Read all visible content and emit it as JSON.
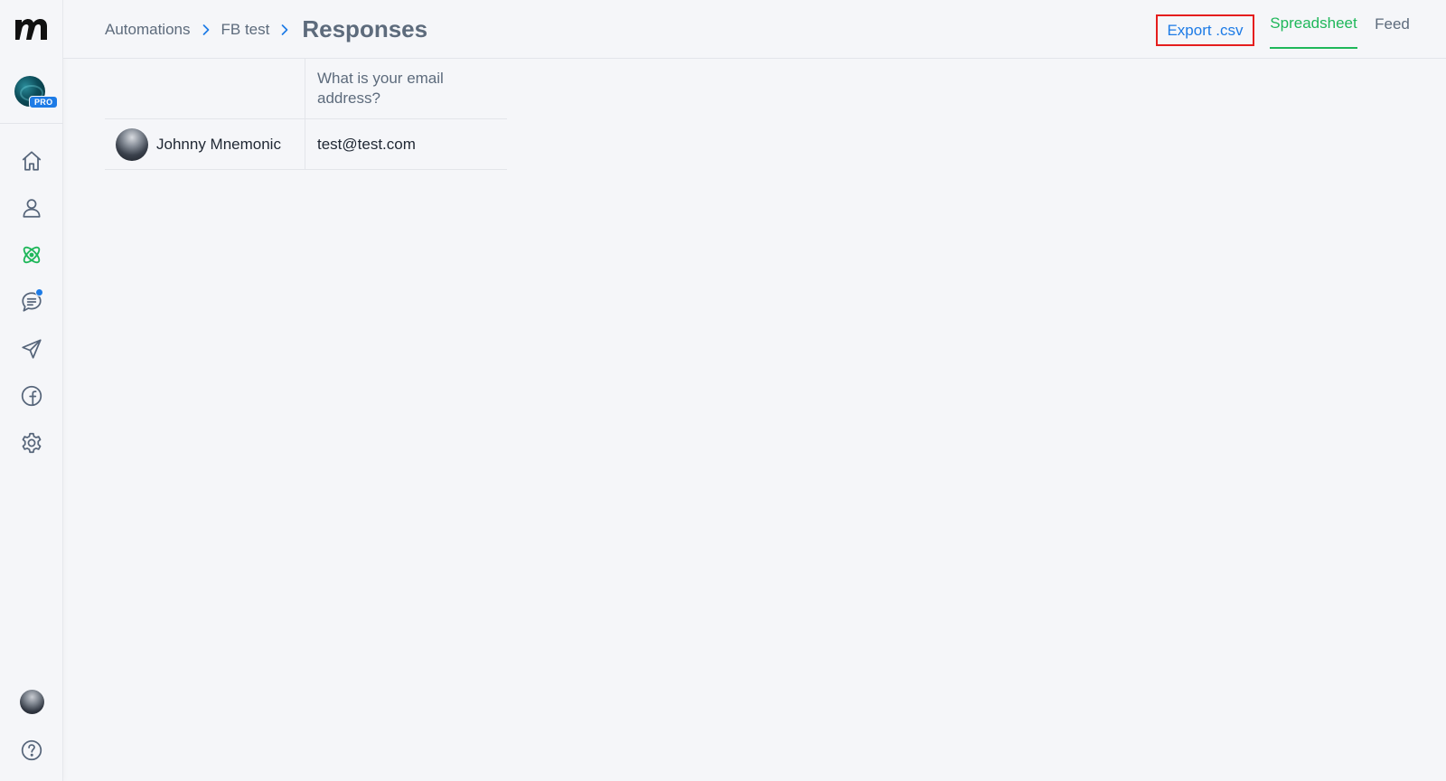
{
  "sidebar": {
    "logo_icon": "manychat-logo-icon",
    "pro_badge": "PRO",
    "nav_items": [
      {
        "icon": "home-icon"
      },
      {
        "icon": "user-icon"
      },
      {
        "icon": "automation-atom-icon",
        "active": true
      },
      {
        "icon": "chat-icon",
        "notification": true
      },
      {
        "icon": "send-icon"
      },
      {
        "icon": "facebook-icon"
      },
      {
        "icon": "settings-gear-icon"
      }
    ],
    "bottom": [
      {
        "icon": "user-avatar"
      },
      {
        "icon": "help-icon"
      }
    ]
  },
  "header": {
    "breadcrumb": [
      "Automations",
      "FB test"
    ],
    "title": "Responses",
    "export_label": "Export .csv",
    "tabs": [
      {
        "label": "Spreadsheet",
        "active": true
      },
      {
        "label": "Feed",
        "active": false
      }
    ]
  },
  "table": {
    "columns": [
      "",
      "What is your email address?"
    ],
    "rows": [
      {
        "name": "Johnny Mnemonic",
        "email": "test@test.com"
      }
    ]
  },
  "colors": {
    "accent_green": "#1fb75a",
    "link_blue": "#1d7be6",
    "highlight_red": "#e51d1d",
    "text_muted": "#5d6b7c",
    "background": "#f5f6f9"
  }
}
